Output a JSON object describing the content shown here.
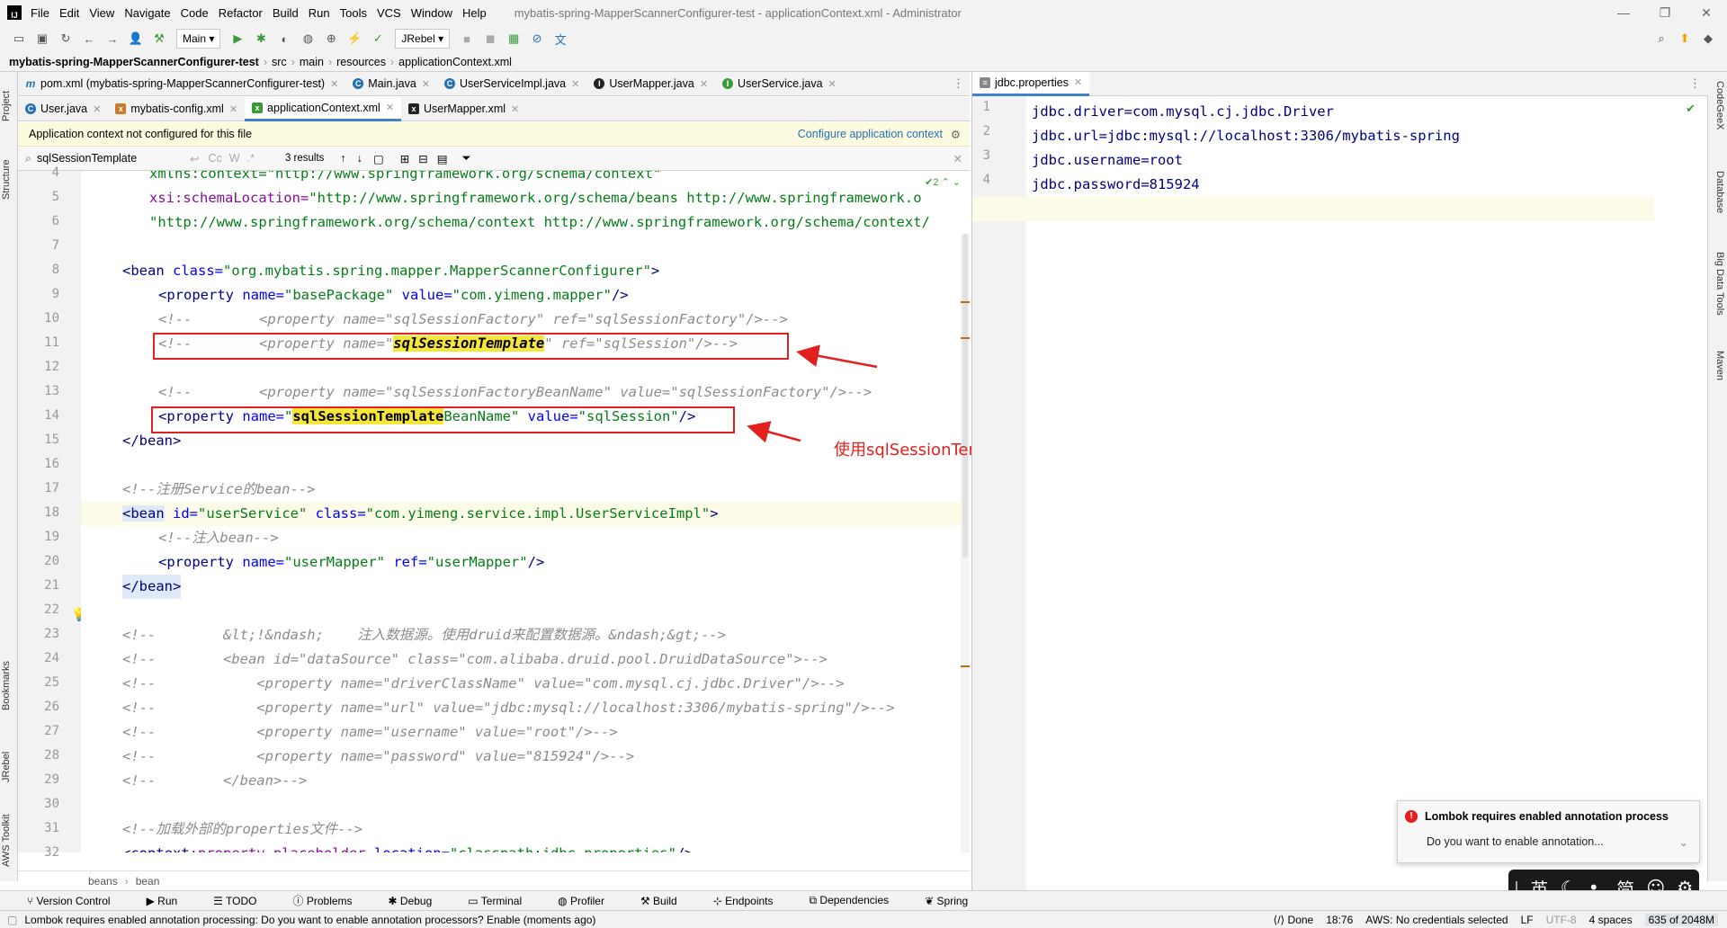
{
  "window": {
    "logo": "IJ",
    "menus": [
      "File",
      "Edit",
      "View",
      "Navigate",
      "Code",
      "Refactor",
      "Build",
      "Run",
      "Tools",
      "VCS",
      "Window",
      "Help"
    ],
    "title": "mybatis-spring-MapperScannerConfigurer-test - applicationContext.xml - Administrator"
  },
  "toolbar": {
    "run_config": "Main",
    "jrebel": "JRebel"
  },
  "breadcrumb": [
    "mybatis-spring-MapperScannerConfigurer-test",
    "src",
    "main",
    "resources",
    "applicationContext.xml"
  ],
  "left_tool_tabs": [
    "Project",
    "Structure",
    "Bookmarks",
    "JRebel",
    "AWS Toolkit"
  ],
  "right_tool_tabs": [
    "CodeGeeX",
    "Database",
    "Big Data Tools",
    "Maven"
  ],
  "editor_tabs_row1": [
    {
      "label": "pom.xml (mybatis-spring-MapperScannerConfigurer-test)",
      "icon": "m"
    },
    {
      "label": "Main.java",
      "icon": "C"
    },
    {
      "label": "UserServiceImpl.java",
      "icon": "C"
    },
    {
      "label": "UserMapper.java",
      "icon": "I"
    },
    {
      "label": "UserService.java",
      "icon": "I"
    }
  ],
  "editor_tabs_row2": [
    {
      "label": "User.java",
      "icon": "C"
    },
    {
      "label": "mybatis-config.xml",
      "icon": "x"
    },
    {
      "label": "applicationContext.xml",
      "icon": "x",
      "active": true
    },
    {
      "label": "UserMapper.xml",
      "icon": "x"
    }
  ],
  "banner": {
    "text": "Application context not configured for this file",
    "link": "Configure application context"
  },
  "search": {
    "query": "sqlSessionTemplate",
    "results": "3 results",
    "opt_cc": "Cc",
    "opt_w": "W",
    "opt_regex": ".*"
  },
  "inspection": "2",
  "code_lines": [
    {
      "n": "4"
    },
    {
      "n": "5"
    },
    {
      "n": "6"
    },
    {
      "n": "7"
    },
    {
      "n": "8"
    },
    {
      "n": "9"
    },
    {
      "n": "10"
    },
    {
      "n": "11"
    },
    {
      "n": "12"
    },
    {
      "n": "13"
    },
    {
      "n": "14"
    },
    {
      "n": "15"
    },
    {
      "n": "16"
    },
    {
      "n": "17"
    },
    {
      "n": "18"
    },
    {
      "n": "19"
    },
    {
      "n": "20"
    },
    {
      "n": "21"
    },
    {
      "n": "22"
    },
    {
      "n": "23"
    },
    {
      "n": "24"
    },
    {
      "n": "25"
    },
    {
      "n": "26"
    },
    {
      "n": "27"
    },
    {
      "n": "28"
    },
    {
      "n": "29"
    },
    {
      "n": "30"
    },
    {
      "n": "31"
    },
    {
      "n": "32"
    }
  ],
  "code": {
    "l4": "xmlns:context=\"http://www.springframework.org/schema/context\"",
    "l5a": "xsi:schemaLocation=",
    "l5b": "\"http://www.springframework.org/schema/beans http://www.springframework.o",
    "l6": "\"http://www.springframework.org/schema/context http://www.springframework.org/schema/context/",
    "l8a": "<bean ",
    "l8b": "class=",
    "l8c": "\"org.mybatis.spring.mapper.MapperScannerConfigurer\"",
    "l8d": ">",
    "l9a": "<property ",
    "l9b": "name=",
    "l9c": "\"basePackage\" ",
    "l9d": "value=",
    "l9e": "\"com.yimeng.mapper\"",
    "l9f": "/>",
    "l10": "<!--        <property name=\"sqlSessionFactory\" ref=\"sqlSessionFactory\"/>-->",
    "l11a": "<!--        <property name=\"",
    "l11b": "sqlSessionTemplate",
    "l11c": "\" ref=\"sqlSession\"/>-->",
    "l13": "<!--        <property name=\"sqlSessionFactoryBeanName\" value=\"sqlSessionFactory\"/>-->",
    "l14a": "<property ",
    "l14b": "name=",
    "l14c": "\"",
    "l14d": "sqlSessionTemplate",
    "l14e": "BeanName\" ",
    "l14f": "value=",
    "l14g": "\"sqlSession\"",
    "l14h": "/>",
    "l15": "</bean>",
    "l17": "<!--注册Service的bean-->",
    "l18a": "<bean",
    "l18b": " id=",
    "l18c": "\"userService\" ",
    "l18d": "class=",
    "l18e": "\"com.yimeng.service.impl.UserServiceImpl\"",
    "l18f": ">",
    "l19": "<!--注入bean-->",
    "l20a": "<property ",
    "l20b": "name=",
    "l20c": "\"userMapper\" ",
    "l20d": "ref=",
    "l20e": "\"userMapper\"",
    "l20f": "/>",
    "l21": "</bean>",
    "l23": "<!--        &lt;!&ndash;    注入数据源。使用druid来配置数据源。&ndash;&gt;-->",
    "l24": "<!--        <bean id=\"dataSource\" class=\"com.alibaba.druid.pool.DruidDataSource\">-->",
    "l25": "<!--            <property name=\"driverClassName\" value=\"com.mysql.cj.jdbc.Driver\"/>-->",
    "l26": "<!--            <property name=\"url\" value=\"jdbc:mysql://localhost:3306/mybatis-spring\"/>-->",
    "l27": "<!--            <property name=\"username\" value=\"root\"/>-->",
    "l28": "<!--            <property name=\"password\" value=\"815924\"/>-->",
    "l29": "<!--        </bean>-->",
    "l31": "<!--加载外部的properties文件-->",
    "l32a": "<context",
    "l32b": ":property-placeholder ",
    "l32c": "location=",
    "l32d": "\"classpath:jdbc.properties\"",
    "l32e": "/>"
  },
  "annotation": "使用sqlSessionTemplateBeanName替代sqlSessionTemplate",
  "editor_breadcrumb": [
    "beans",
    "bean"
  ],
  "right_pane": {
    "tab": "jdbc.properties",
    "lines": [
      {
        "n": "1",
        "text": "jdbc.driver=com.mysql.cj.jdbc.Driver"
      },
      {
        "n": "2",
        "text": "jdbc.url=jdbc:mysql://localhost:3306/mybatis-spring"
      },
      {
        "n": "3",
        "text": "jdbc.username=root"
      },
      {
        "n": "4",
        "text": "jdbc.password=815924"
      },
      {
        "n": "5",
        "text": ""
      }
    ]
  },
  "tool_windows": [
    "Version Control",
    "Run",
    "TODO",
    "Problems",
    "Debug",
    "Terminal",
    "Profiler",
    "Build",
    "Endpoints",
    "Dependencies",
    "Spring"
  ],
  "status": {
    "message": "Lombok requires enabled annotation processing: Do you want to enable annotation processors? Enable (moments ago)",
    "done": "Done",
    "pos": "18:76",
    "aws": "AWS: No credentials selected",
    "sep": "LF",
    "enc": "UTF-8",
    "indent": "4 spaces",
    "mem": "635 of 2048M"
  },
  "notification": {
    "title": "Lombok requires enabled annotation process",
    "body": "Do you want to enable annotation..."
  },
  "ime": [
    "英",
    "简"
  ],
  "colors": {
    "accent": "#4083c9",
    "red": "#e32020",
    "highlight": "#f7e63a"
  }
}
